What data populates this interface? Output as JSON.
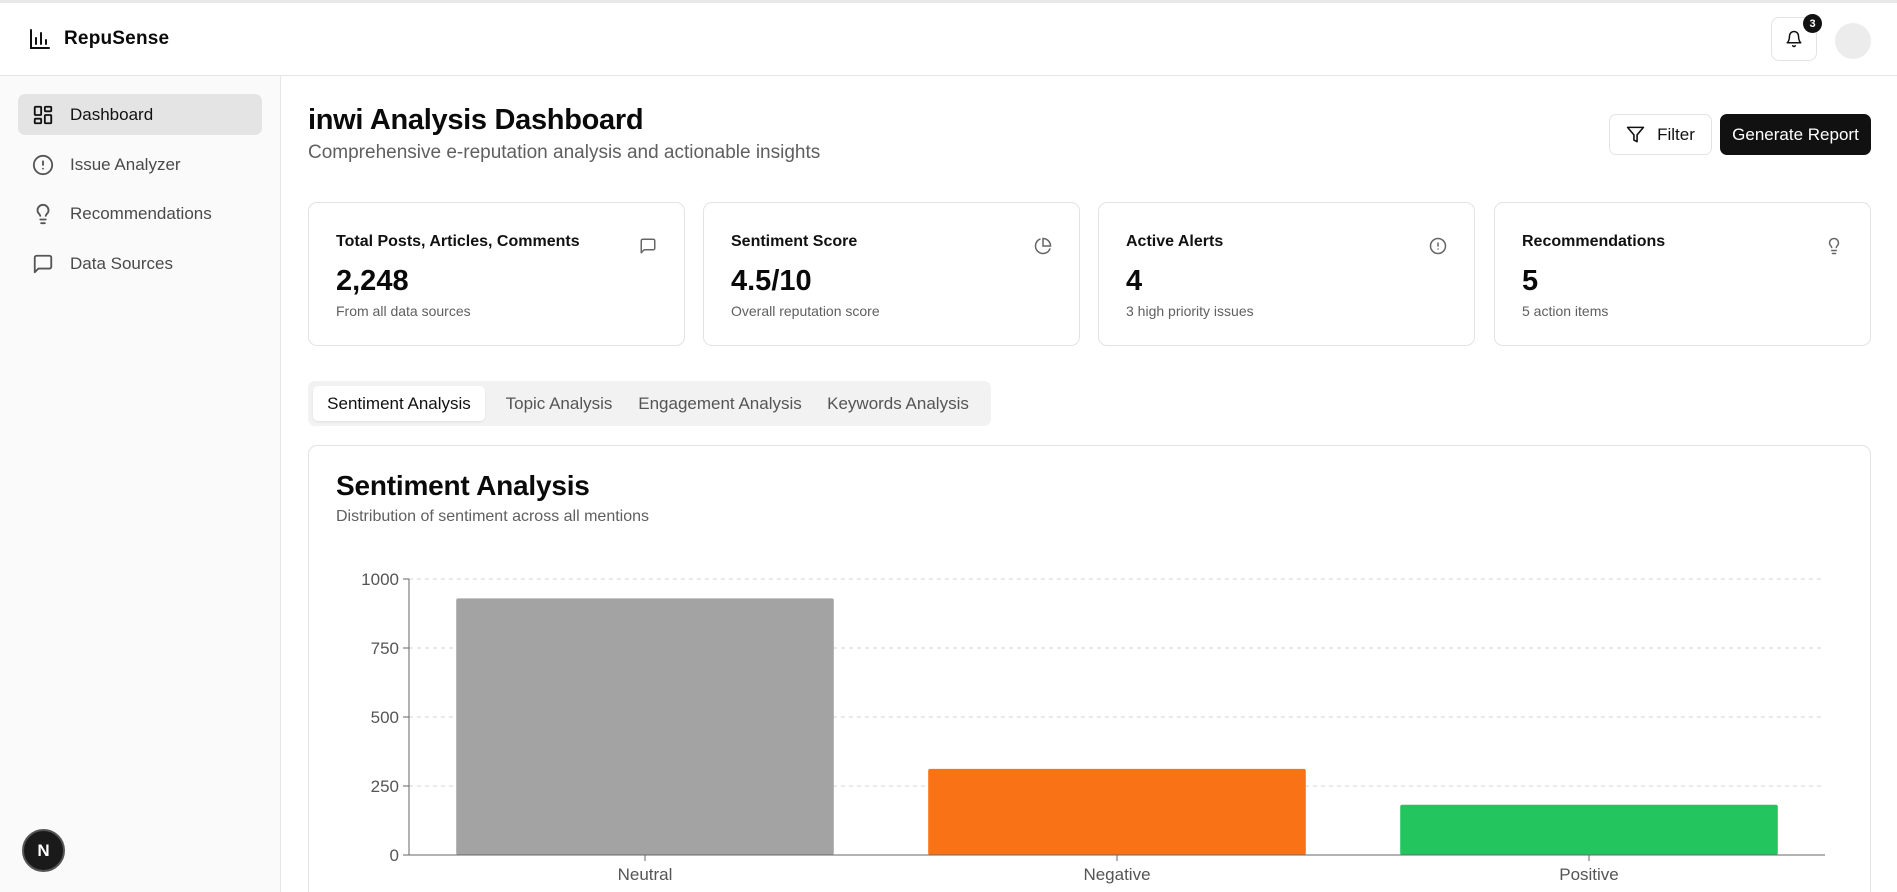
{
  "app": {
    "name": "RepuSense"
  },
  "header": {
    "notification_count": "3"
  },
  "sidebar": {
    "items": [
      {
        "label": "Dashboard",
        "icon": "dashboard-icon",
        "active": true
      },
      {
        "label": "Issue Analyzer",
        "icon": "alert-circle-icon",
        "active": false
      },
      {
        "label": "Recommendations",
        "icon": "lightbulb-icon",
        "active": false
      },
      {
        "label": "Data Sources",
        "icon": "message-square-icon",
        "active": false
      }
    ],
    "badge": "N"
  },
  "page": {
    "title": "inwi Analysis Dashboard",
    "subtitle": "Comprehensive e-reputation analysis and actionable insights",
    "filter_label": "Filter",
    "report_label": "Generate Report"
  },
  "cards": [
    {
      "title": "Total Posts, Articles, Comments",
      "value": "2,248",
      "note": "From all data sources",
      "icon": "message-icon"
    },
    {
      "title": "Sentiment Score",
      "value": "4.5/10",
      "note": "Overall reputation score",
      "icon": "pie-chart-icon"
    },
    {
      "title": "Active Alerts",
      "value": "4",
      "note": "3 high priority issues",
      "icon": "alert-circle-icon"
    },
    {
      "title": "Recommendations",
      "value": "5",
      "note": "5 action items",
      "icon": "lightbulb-icon"
    }
  ],
  "tabs": [
    {
      "label": "Sentiment Analysis",
      "active": true
    },
    {
      "label": "Topic Analysis",
      "active": false
    },
    {
      "label": "Engagement Analysis",
      "active": false
    },
    {
      "label": "Keywords Analysis",
      "active": false
    }
  ],
  "chart_section": {
    "title": "Sentiment Analysis",
    "subtitle": "Distribution of sentiment across all mentions"
  },
  "chart_data": {
    "type": "bar",
    "title": "Sentiment Analysis",
    "categories": [
      "Neutral",
      "Negative",
      "Positive"
    ],
    "values": [
      930,
      312,
      182
    ],
    "colors": [
      "#a3a3a3",
      "#f97316",
      "#22c55e"
    ],
    "ylim": [
      0,
      1000
    ],
    "yticks": [
      0,
      250,
      500,
      750,
      1000
    ],
    "grid": true,
    "xlabel": "",
    "ylabel": ""
  }
}
